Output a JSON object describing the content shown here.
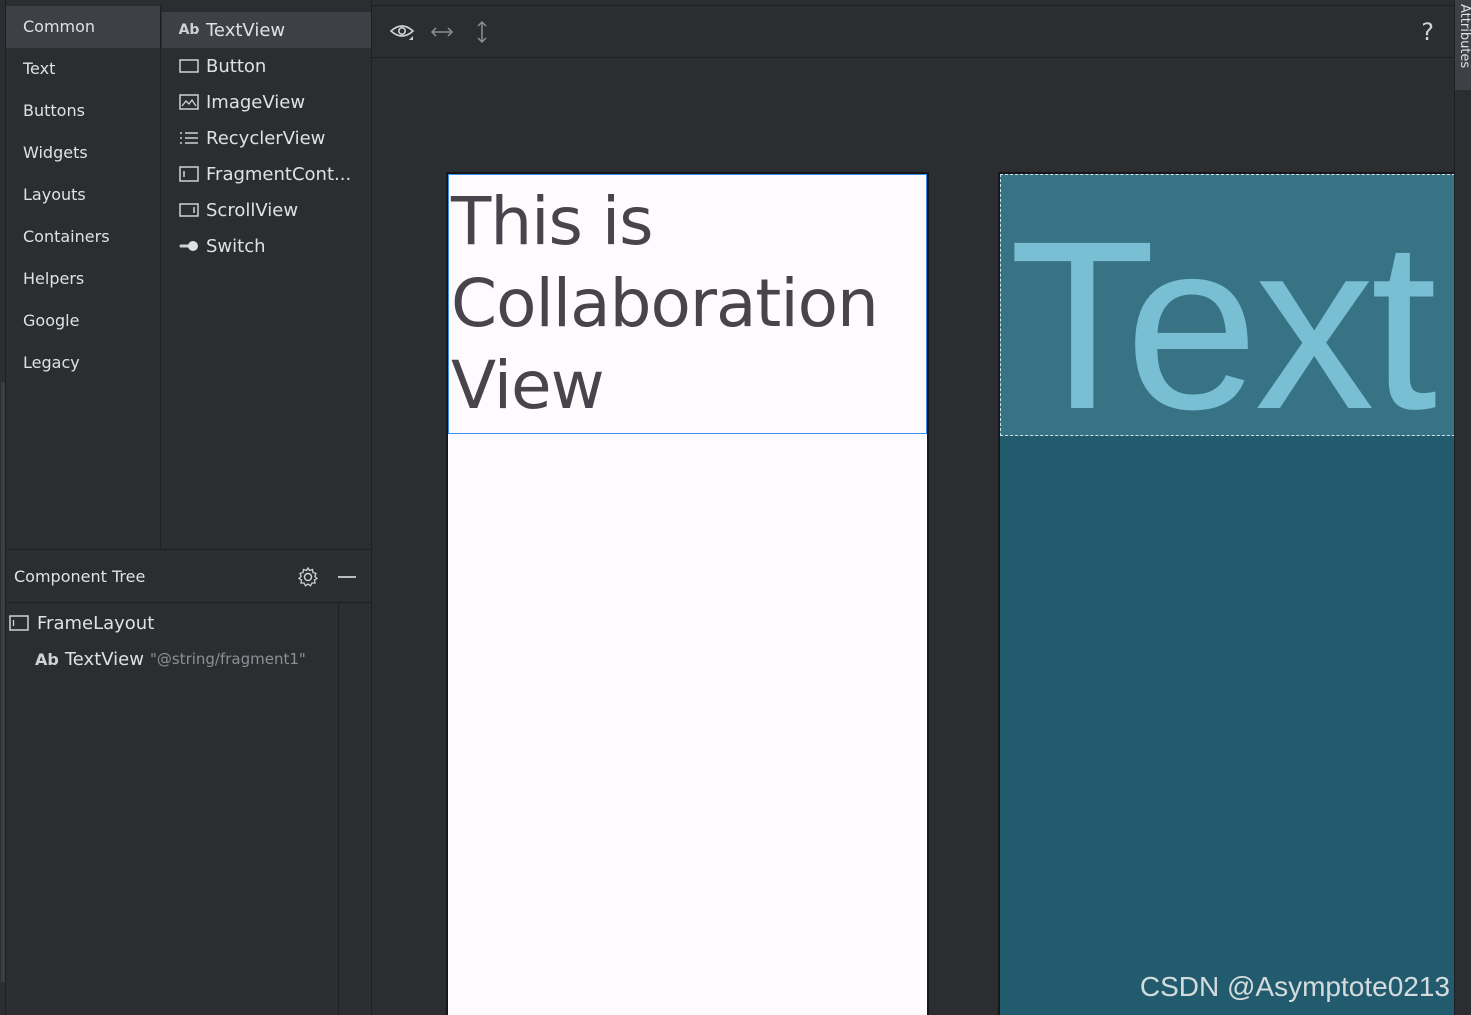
{
  "palette": {
    "categories": [
      {
        "label": "Common",
        "selected": true
      },
      {
        "label": "Text"
      },
      {
        "label": "Buttons"
      },
      {
        "label": "Widgets"
      },
      {
        "label": "Layouts"
      },
      {
        "label": "Containers"
      },
      {
        "label": "Helpers"
      },
      {
        "label": "Google"
      },
      {
        "label": "Legacy"
      }
    ],
    "widgets": [
      {
        "label": "TextView",
        "icon": "textview-icon",
        "selected": true
      },
      {
        "label": "Button",
        "icon": "button-icon"
      },
      {
        "label": "ImageView",
        "icon": "imageview-icon"
      },
      {
        "label": "RecyclerView",
        "icon": "recyclerview-icon"
      },
      {
        "label": "FragmentCont...",
        "icon": "fragmentcontainer-icon"
      },
      {
        "label": "ScrollView",
        "icon": "scrollview-icon"
      },
      {
        "label": "Switch",
        "icon": "switch-icon"
      }
    ],
    "ab_glyph": "Ab"
  },
  "component_tree": {
    "title": "Component Tree",
    "nodes": [
      {
        "label": "FrameLayout",
        "icon": "framelayout-icon"
      },
      {
        "label": "TextView",
        "icon": "textview-icon",
        "hint": "\"@string/fragment1\""
      }
    ]
  },
  "toolbar": {
    "help_label": "?"
  },
  "design": {
    "text_line1": "This is",
    "text_line2": "Collaboration",
    "text_line3": "View"
  },
  "blueprint": {
    "text": "Text"
  },
  "watermark": "CSDN @Asymptote0213",
  "side_tab": "Attributes",
  "colors": {
    "background": "#2b2d30",
    "selection": "#3d4045",
    "design_surface": "#fefbfe",
    "selection_border": "#3d8ee8",
    "blueprint": "#235b6e",
    "blueprint_text": "#79bfd4"
  }
}
